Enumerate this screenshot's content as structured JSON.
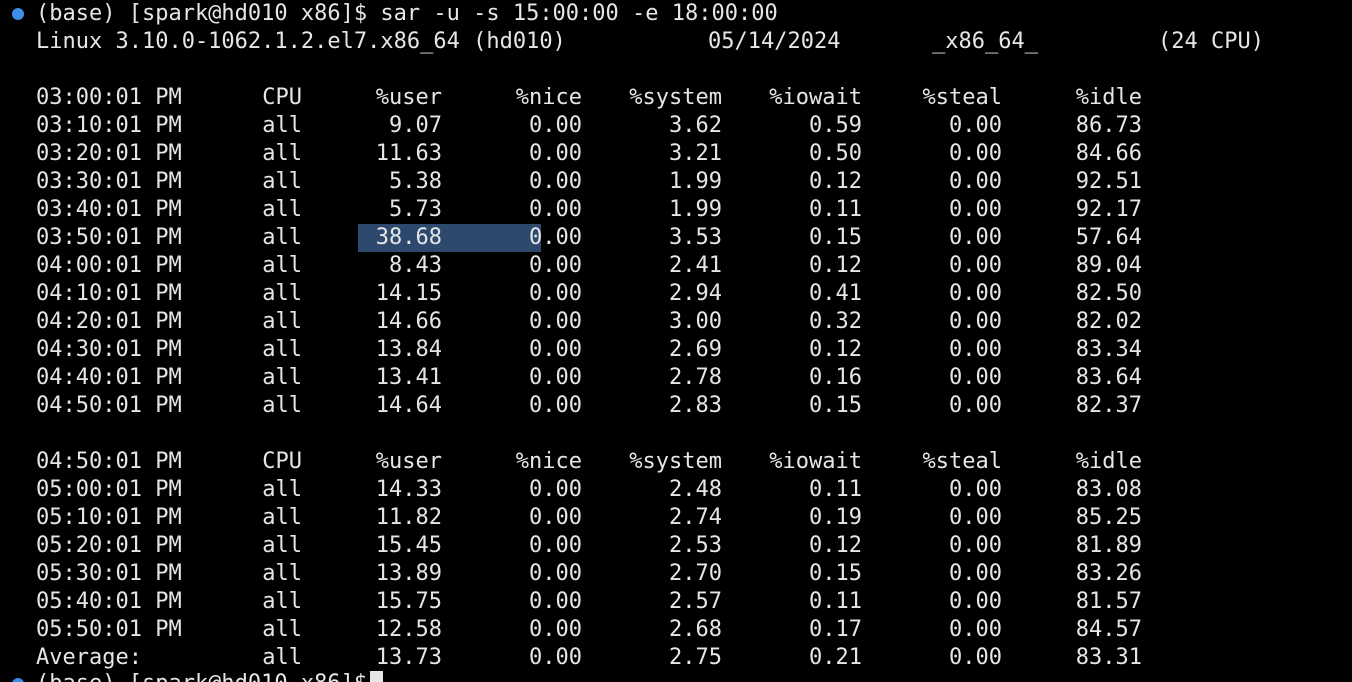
{
  "command": {
    "prompt": "(base) [spark@hd010 x86]$ sar -u -s 15:00:00 -e 18:00:00"
  },
  "sysinfo": {
    "kernel": "Linux 3.10.0-1062.1.2.el7.x86_64 (hd010)",
    "date": "05/14/2024",
    "arch": "_x86_64_",
    "cpus": "(24 CPU)"
  },
  "headers": [
    "CPU",
    "%user",
    "%nice",
    "%system",
    "%iowait",
    "%steal",
    "%idle"
  ],
  "block1": {
    "header_time": "03:00:01 PM",
    "rows": [
      {
        "time": "03:10:01 PM",
        "cpu": "all",
        "user": "9.07",
        "nice": "0.00",
        "system": "3.62",
        "iowait": "0.59",
        "steal": "0.00",
        "idle": "86.73"
      },
      {
        "time": "03:20:01 PM",
        "cpu": "all",
        "user": "11.63",
        "nice": "0.00",
        "system": "3.21",
        "iowait": "0.50",
        "steal": "0.00",
        "idle": "84.66"
      },
      {
        "time": "03:30:01 PM",
        "cpu": "all",
        "user": "5.38",
        "nice": "0.00",
        "system": "1.99",
        "iowait": "0.12",
        "steal": "0.00",
        "idle": "92.51"
      },
      {
        "time": "03:40:01 PM",
        "cpu": "all",
        "user": "5.73",
        "nice": "0.00",
        "system": "1.99",
        "iowait": "0.11",
        "steal": "0.00",
        "idle": "92.17"
      },
      {
        "time": "03:50:01 PM",
        "cpu": "all",
        "user": "38.68",
        "nice": "0.00",
        "system": "3.53",
        "iowait": "0.15",
        "steal": "0.00",
        "idle": "57.64"
      },
      {
        "time": "04:00:01 PM",
        "cpu": "all",
        "user": "8.43",
        "nice": "0.00",
        "system": "2.41",
        "iowait": "0.12",
        "steal": "0.00",
        "idle": "89.04"
      },
      {
        "time": "04:10:01 PM",
        "cpu": "all",
        "user": "14.15",
        "nice": "0.00",
        "system": "2.94",
        "iowait": "0.41",
        "steal": "0.00",
        "idle": "82.50"
      },
      {
        "time": "04:20:01 PM",
        "cpu": "all",
        "user": "14.66",
        "nice": "0.00",
        "system": "3.00",
        "iowait": "0.32",
        "steal": "0.00",
        "idle": "82.02"
      },
      {
        "time": "04:30:01 PM",
        "cpu": "all",
        "user": "13.84",
        "nice": "0.00",
        "system": "2.69",
        "iowait": "0.12",
        "steal": "0.00",
        "idle": "83.34"
      },
      {
        "time": "04:40:01 PM",
        "cpu": "all",
        "user": "13.41",
        "nice": "0.00",
        "system": "2.78",
        "iowait": "0.16",
        "steal": "0.00",
        "idle": "83.64"
      },
      {
        "time": "04:50:01 PM",
        "cpu": "all",
        "user": "14.64",
        "nice": "0.00",
        "system": "2.83",
        "iowait": "0.15",
        "steal": "0.00",
        "idle": "82.37"
      }
    ]
  },
  "block2": {
    "header_time": "04:50:01 PM",
    "rows": [
      {
        "time": "05:00:01 PM",
        "cpu": "all",
        "user": "14.33",
        "nice": "0.00",
        "system": "2.48",
        "iowait": "0.11",
        "steal": "0.00",
        "idle": "83.08"
      },
      {
        "time": "05:10:01 PM",
        "cpu": "all",
        "user": "11.82",
        "nice": "0.00",
        "system": "2.74",
        "iowait": "0.19",
        "steal": "0.00",
        "idle": "85.25"
      },
      {
        "time": "05:20:01 PM",
        "cpu": "all",
        "user": "15.45",
        "nice": "0.00",
        "system": "2.53",
        "iowait": "0.12",
        "steal": "0.00",
        "idle": "81.89"
      },
      {
        "time": "05:30:01 PM",
        "cpu": "all",
        "user": "13.89",
        "nice": "0.00",
        "system": "2.70",
        "iowait": "0.15",
        "steal": "0.00",
        "idle": "83.26"
      },
      {
        "time": "05:40:01 PM",
        "cpu": "all",
        "user": "15.75",
        "nice": "0.00",
        "system": "2.57",
        "iowait": "0.11",
        "steal": "0.00",
        "idle": "81.57"
      },
      {
        "time": "05:50:01 PM",
        "cpu": "all",
        "user": "12.58",
        "nice": "0.00",
        "system": "2.68",
        "iowait": "0.17",
        "steal": "0.00",
        "idle": "84.57"
      },
      {
        "time": "Average:",
        "cpu": "all",
        "user": "13.73",
        "nice": "0.00",
        "system": "2.75",
        "iowait": "0.21",
        "steal": "0.00",
        "idle": "83.31"
      }
    ]
  },
  "final_prompt": "(base) [spark@hd010 x86]$",
  "colors": {
    "background": "#000000",
    "text": "#e6e6e6",
    "prompt_dot": "#3b8eea",
    "selection": "#2d4a6e"
  }
}
